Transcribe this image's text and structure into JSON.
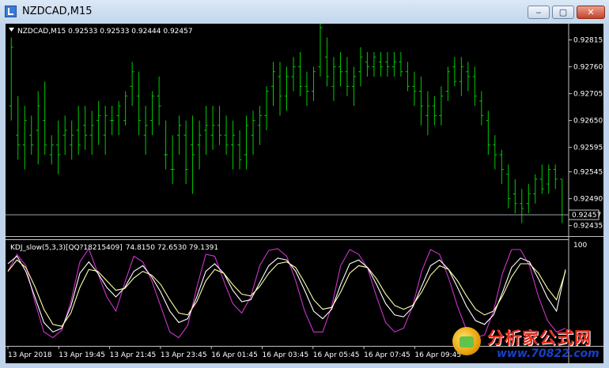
{
  "window": {
    "title": "NZDCAD,M15",
    "minimize_glyph": "‒",
    "maximize_glyph": "▢",
    "close_glyph": "✕"
  },
  "chart_data": [
    {
      "type": "bar",
      "style": "OHLC price bars",
      "symbol_header": "NZDCAD,M15  0.92533 0.92533 0.92444 0.92457",
      "current_price_label": "0.92457",
      "current_price": 0.92457,
      "ylim": [
        0.92415,
        0.92845
      ],
      "y_ticks": [
        "0.92815",
        "0.92760",
        "0.92705",
        "0.92650",
        "0.92595",
        "0.92545",
        "0.92490",
        "0.92435"
      ],
      "color": "#00cc00",
      "bars": [
        [
          0.9268,
          0.9282,
          0.9265,
          0.928
        ],
        [
          0.9262,
          0.927,
          0.9257,
          0.926
        ],
        [
          0.926,
          0.9268,
          0.9255,
          0.9265
        ],
        [
          0.9262,
          0.9266,
          0.9258,
          0.926
        ],
        [
          0.9263,
          0.9271,
          0.9256,
          0.9268
        ],
        [
          0.9265,
          0.9273,
          0.9258,
          0.926
        ],
        [
          0.9258,
          0.9262,
          0.9256,
          0.926
        ],
        [
          0.926,
          0.9265,
          0.9254,
          0.9258
        ],
        [
          0.9262,
          0.9266,
          0.9258,
          0.9263
        ],
        [
          0.926,
          0.9265,
          0.9257,
          0.9262
        ],
        [
          0.9263,
          0.9268,
          0.9258,
          0.926
        ],
        [
          0.9264,
          0.9268,
          0.9259,
          0.9262
        ],
        [
          0.9262,
          0.9267,
          0.9258,
          0.9264
        ],
        [
          0.9265,
          0.9269,
          0.926,
          0.9266
        ],
        [
          0.9262,
          0.9268,
          0.9258,
          0.9266
        ],
        [
          0.9265,
          0.9268,
          0.9262,
          0.9265
        ],
        [
          0.9266,
          0.9269,
          0.9262,
          0.9268
        ],
        [
          0.9265,
          0.9271,
          0.9264,
          0.927
        ],
        [
          0.9272,
          0.9277,
          0.9268,
          0.9275
        ],
        [
          0.927,
          0.9275,
          0.9262,
          0.9265
        ],
        [
          0.9262,
          0.9268,
          0.9258,
          0.9264
        ],
        [
          0.9265,
          0.9271,
          0.9262,
          0.927
        ],
        [
          0.927,
          0.9274,
          0.9264,
          0.9268
        ],
        [
          0.9258,
          0.9265,
          0.9255,
          0.9258
        ],
        [
          0.9255,
          0.9262,
          0.9252,
          0.9255
        ],
        [
          0.9262,
          0.9266,
          0.9258,
          0.9264
        ],
        [
          0.9262,
          0.9265,
          0.9252,
          0.9255
        ],
        [
          0.926,
          0.9266,
          0.925,
          0.9258
        ],
        [
          0.926,
          0.9265,
          0.9255,
          0.9262
        ],
        [
          0.9263,
          0.9268,
          0.9258,
          0.9264
        ],
        [
          0.9262,
          0.9268,
          0.9259,
          0.9264
        ],
        [
          0.9264,
          0.9268,
          0.926,
          0.9262
        ],
        [
          0.9262,
          0.9266,
          0.9258,
          0.926
        ],
        [
          0.926,
          0.9265,
          0.9255,
          0.9262
        ],
        [
          0.926,
          0.9263,
          0.9255,
          0.9257
        ],
        [
          0.9258,
          0.9266,
          0.9255,
          0.9264
        ],
        [
          0.9262,
          0.9267,
          0.9258,
          0.9265
        ],
        [
          0.9264,
          0.9268,
          0.926,
          0.9266
        ],
        [
          0.9266,
          0.9272,
          0.9263,
          0.9271
        ],
        [
          0.9272,
          0.9277,
          0.9268,
          0.9275
        ],
        [
          0.9274,
          0.9277,
          0.9266,
          0.927
        ],
        [
          0.927,
          0.9276,
          0.9267,
          0.9274
        ],
        [
          0.9274,
          0.9278,
          0.9271,
          0.9276
        ],
        [
          0.9276,
          0.9279,
          0.927,
          0.9272
        ],
        [
          0.9272,
          0.9275,
          0.9268,
          0.9271
        ],
        [
          0.9271,
          0.9276,
          0.9269,
          0.9275
        ],
        [
          0.9276,
          0.9285,
          0.9274,
          0.9284
        ],
        [
          0.9278,
          0.9282,
          0.9272,
          0.9274
        ],
        [
          0.9272,
          0.9278,
          0.9269,
          0.9276
        ],
        [
          0.9276,
          0.9279,
          0.9272,
          0.9275
        ],
        [
          0.9275,
          0.9278,
          0.927,
          0.9272
        ],
        [
          0.9272,
          0.9276,
          0.9268,
          0.9274
        ],
        [
          0.9275,
          0.928,
          0.9272,
          0.9278
        ],
        [
          0.9277,
          0.9279,
          0.9274,
          0.9276
        ],
        [
          0.9276,
          0.9279,
          0.9274,
          0.9278
        ],
        [
          0.9277,
          0.9279,
          0.9274,
          0.9276
        ],
        [
          0.9277,
          0.9279,
          0.9274,
          0.9276
        ],
        [
          0.9276,
          0.9279,
          0.9274,
          0.9277
        ],
        [
          0.9277,
          0.9279,
          0.9274,
          0.9275
        ],
        [
          0.9275,
          0.9277,
          0.9271,
          0.9272
        ],
        [
          0.9272,
          0.9275,
          0.9268,
          0.9271
        ],
        [
          0.9271,
          0.9274,
          0.9264,
          0.9268
        ],
        [
          0.9266,
          0.9271,
          0.9262,
          0.9268
        ],
        [
          0.9268,
          0.927,
          0.9264,
          0.9266
        ],
        [
          0.9266,
          0.9272,
          0.9264,
          0.927
        ],
        [
          0.9271,
          0.9276,
          0.9269,
          0.9275
        ],
        [
          0.9276,
          0.9278,
          0.9272,
          0.9273
        ],
        [
          0.9273,
          0.9278,
          0.927,
          0.9276
        ],
        [
          0.9275,
          0.9277,
          0.9271,
          0.9274
        ],
        [
          0.9274,
          0.9276,
          0.9268,
          0.927
        ],
        [
          0.9269,
          0.9271,
          0.9264,
          0.9266
        ],
        [
          0.9265,
          0.9267,
          0.9258,
          0.926
        ],
        [
          0.926,
          0.9262,
          0.9255,
          0.9258
        ],
        [
          0.9258,
          0.9259,
          0.9252,
          0.9255
        ],
        [
          0.9254,
          0.9256,
          0.9247,
          0.9249
        ],
        [
          0.925,
          0.9253,
          0.9246,
          0.9248
        ],
        [
          0.9248,
          0.9251,
          0.9244,
          0.9247
        ],
        [
          0.9248,
          0.9252,
          0.9246,
          0.925
        ],
        [
          0.925,
          0.9254,
          0.9248,
          0.9253
        ],
        [
          0.9253,
          0.9256,
          0.925,
          0.9251
        ],
        [
          0.9252,
          0.9256,
          0.925,
          0.9255
        ],
        [
          0.9255,
          0.9256,
          0.9251,
          0.9253
        ],
        [
          0.9253,
          0.9253,
          0.9244,
          0.92457
        ]
      ]
    },
    {
      "type": "line",
      "indicator_header": "KDJ_slow(5,3,3)[QQ?18215409]",
      "values_header": "74.8150 72.6530 79.1391",
      "ylim": [
        0,
        100
      ],
      "y_ticks": [
        "100"
      ],
      "x_tick_labels": [
        "13 Apr 2018",
        "13 Apr 19:45",
        "13 Apr 21:45",
        "13 Apr 23:45",
        "16 Apr 01:45",
        "16 Apr 03:45",
        "16 Apr 05:45",
        "16 Apr 07:45",
        "16 Apr 09:45"
      ],
      "series": [
        {
          "color": "#cc33cc",
          "values": [
            72,
            90,
            78,
            40,
            8,
            2,
            10,
            40,
            82,
            96,
            70,
            45,
            30,
            60,
            88,
            82,
            62,
            35,
            8,
            2,
            15,
            55,
            90,
            88,
            62,
            38,
            28,
            45,
            78,
            94,
            96,
            88,
            62,
            30,
            8,
            8,
            35,
            78,
            95,
            90,
            75,
            45,
            18,
            8,
            12,
            35,
            72,
            95,
            90,
            65,
            35,
            10,
            2,
            5,
            30,
            70,
            95,
            95,
            78,
            45,
            20,
            8,
            12
          ]
        },
        {
          "color": "#ffffff",
          "values": [
            80,
            88,
            72,
            45,
            18,
            8,
            12,
            35,
            70,
            82,
            70,
            55,
            45,
            55,
            72,
            78,
            66,
            50,
            30,
            18,
            22,
            45,
            72,
            80,
            70,
            52,
            40,
            42,
            60,
            78,
            86,
            84,
            72,
            52,
            30,
            22,
            32,
            58,
            80,
            84,
            76,
            58,
            38,
            26,
            24,
            34,
            56,
            78,
            84,
            74,
            55,
            35,
            20,
            16,
            26,
            50,
            76,
            86,
            82,
            64,
            44,
            30,
            74
          ]
        },
        {
          "color": "#ffffaa",
          "values": [
            72,
            84,
            76,
            56,
            32,
            16,
            14,
            28,
            55,
            74,
            72,
            62,
            52,
            54,
            65,
            72,
            68,
            58,
            42,
            28,
            26,
            40,
            62,
            74,
            70,
            58,
            48,
            46,
            56,
            70,
            80,
            82,
            76,
            60,
            42,
            32,
            34,
            50,
            70,
            78,
            76,
            64,
            48,
            36,
            32,
            36,
            50,
            68,
            78,
            74,
            62,
            46,
            32,
            26,
            30,
            46,
            66,
            80,
            80,
            70,
            54,
            42,
            72
          ]
        }
      ]
    }
  ]
}
